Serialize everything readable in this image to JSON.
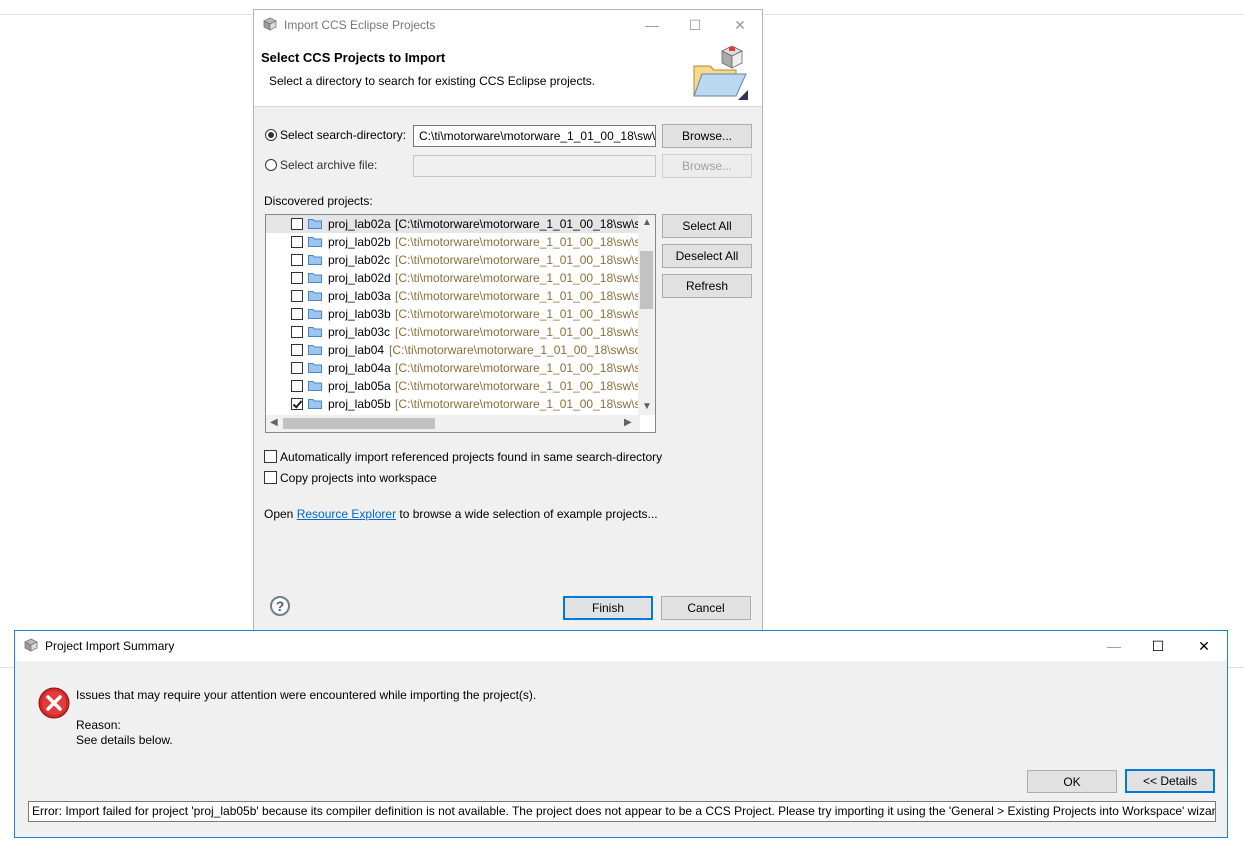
{
  "import_dialog": {
    "title": "Import CCS Eclipse Projects",
    "header_title": "Select CCS Projects to Import",
    "header_subtitle": "Select a directory to search for existing CCS Eclipse projects.",
    "search_dir_label": "Select search-directory:",
    "search_dir_value": "C:\\ti\\motorware\\motorware_1_01_00_18\\sw\\",
    "archive_label": "Select archive file:",
    "archive_value": "",
    "browse_label": "Browse...",
    "browse2_label": "Browse...",
    "discovered_label": "Discovered projects:",
    "projects": [
      {
        "name": "proj_lab02a",
        "path": "[C:\\ti\\motorware\\motorware_1_01_00_18\\sw\\s",
        "checked": false,
        "selected": true
      },
      {
        "name": "proj_lab02b",
        "path": "[C:\\ti\\motorware\\motorware_1_01_00_18\\sw\\s",
        "checked": false,
        "selected": false
      },
      {
        "name": "proj_lab02c",
        "path": "[C:\\ti\\motorware\\motorware_1_01_00_18\\sw\\s",
        "checked": false,
        "selected": false
      },
      {
        "name": "proj_lab02d",
        "path": "[C:\\ti\\motorware\\motorware_1_01_00_18\\sw\\s",
        "checked": false,
        "selected": false
      },
      {
        "name": "proj_lab03a",
        "path": "[C:\\ti\\motorware\\motorware_1_01_00_18\\sw\\s",
        "checked": false,
        "selected": false
      },
      {
        "name": "proj_lab03b",
        "path": "[C:\\ti\\motorware\\motorware_1_01_00_18\\sw\\s",
        "checked": false,
        "selected": false
      },
      {
        "name": "proj_lab03c",
        "path": "[C:\\ti\\motorware\\motorware_1_01_00_18\\sw\\s",
        "checked": false,
        "selected": false
      },
      {
        "name": "proj_lab04",
        "path": "[C:\\ti\\motorware\\motorware_1_01_00_18\\sw\\so",
        "checked": false,
        "selected": false
      },
      {
        "name": "proj_lab04a",
        "path": "[C:\\ti\\motorware\\motorware_1_01_00_18\\sw\\s",
        "checked": false,
        "selected": false
      },
      {
        "name": "proj_lab05a",
        "path": "[C:\\ti\\motorware\\motorware_1_01_00_18\\sw\\s",
        "checked": false,
        "selected": false
      },
      {
        "name": "proj_lab05b",
        "path": "[C:\\ti\\motorware\\motorware_1_01_00_18\\sw\\s",
        "checked": true,
        "selected": false
      }
    ],
    "select_all_label": "Select All",
    "deselect_all_label": "Deselect All",
    "refresh_label": "Refresh",
    "auto_import_label": "Automatically import referenced projects found in same search-directory",
    "copy_label": "Copy projects into workspace",
    "open_prefix": "Open ",
    "resource_explorer_link": "Resource Explorer",
    "open_suffix": " to browse a wide selection of example projects...",
    "help_glyph": "?",
    "finish_label": "Finish",
    "cancel_label": "Cancel"
  },
  "summary_dialog": {
    "title": "Project Import Summary",
    "message": "Issues that may require your attention were encountered while importing the project(s).",
    "reason_label": "Reason:",
    "reason_text": "See details below.",
    "ok_label": "OK",
    "details_label": "<< Details",
    "error_detail": "Error: Import failed for project 'proj_lab05b' because its compiler definition is not available. The project does not appear to be a CCS Project. Please try importing it using the 'General > Existing Projects into Workspace' wizard."
  },
  "window_controls": {
    "minimize": "—",
    "maximize": "☐",
    "close": "✕"
  }
}
